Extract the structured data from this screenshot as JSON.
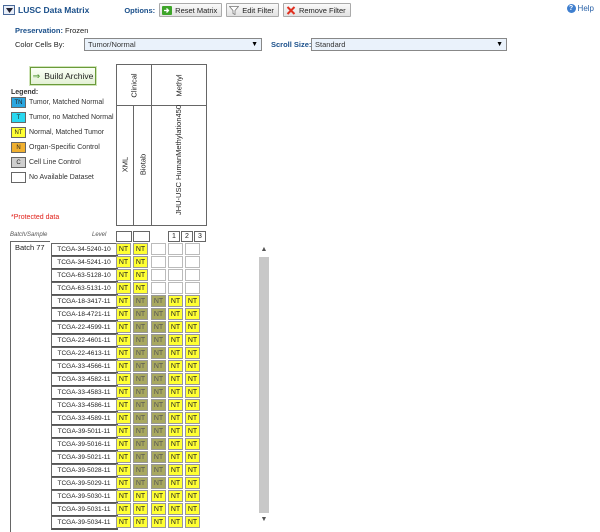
{
  "header": {
    "title": "LUSC Data Matrix",
    "options_label": "Options:",
    "reset_label": "Reset Matrix",
    "edit_label": "Edit Filter",
    "remove_label": "Remove Filter",
    "help_label": "Help"
  },
  "preservation": {
    "label": "Preservation:",
    "value": "Frozen"
  },
  "color_cells": {
    "label": "Color Cells By:",
    "value": "Tumor/Normal"
  },
  "scroll_size": {
    "label": "Scroll Size:",
    "value": "Standard"
  },
  "build_label": "Build Archive",
  "legend": {
    "title": "Legend:",
    "items": [
      {
        "code": "TN",
        "label": "Tumor, Matched Normal",
        "color": "#2aa6e0"
      },
      {
        "code": "T",
        "label": "Tumor, no Matched Normal",
        "color": "#2ad8f0"
      },
      {
        "code": "NT",
        "label": "Normal, Matched Tumor",
        "color": "#ffff33"
      },
      {
        "code": "N",
        "label": "Organ-Specific Control",
        "color": "#f0b030"
      },
      {
        "code": "C",
        "label": "Cell Line Control",
        "color": "#cfcfcf"
      },
      {
        "code": "",
        "label": "No Available Dataset",
        "color": "#ffffff"
      }
    ],
    "protected": "*Protected data"
  },
  "columns": {
    "clinical": "Clinical",
    "methyl": "Methyl",
    "xml": "XML",
    "biotab": "Biotab",
    "platform": "JHU-USC HumanMethylation450",
    "levels": [
      "1",
      "2",
      "3"
    ],
    "batch_sample_label": "Batch/Sample",
    "level_label": "Level"
  },
  "batch": {
    "label": "Batch 77"
  },
  "rows": [
    {
      "id": "TCGA-34-5240-10",
      "cells": [
        "NT",
        "NT",
        "",
        "",
        ""
      ]
    },
    {
      "id": "TCGA-34-5241-10",
      "cells": [
        "NT",
        "NT",
        "",
        "",
        ""
      ]
    },
    {
      "id": "TCGA-63-5128-10",
      "cells": [
        "NT",
        "NT",
        "",
        "",
        ""
      ]
    },
    {
      "id": "TCGA-63-5131-10",
      "cells": [
        "NT",
        "NT",
        "",
        "",
        ""
      ]
    },
    {
      "id": "TCGA-18-3417-11",
      "cells": [
        "NT",
        "NT*",
        "NT*",
        "NT",
        "NT"
      ]
    },
    {
      "id": "TCGA-18-4721-11",
      "cells": [
        "NT",
        "NT*",
        "NT*",
        "NT",
        "NT"
      ]
    },
    {
      "id": "TCGA-22-4599-11",
      "cells": [
        "NT",
        "NT*",
        "NT*",
        "NT",
        "NT"
      ]
    },
    {
      "id": "TCGA-22-4601-11",
      "cells": [
        "NT",
        "NT*",
        "NT*",
        "NT",
        "NT"
      ]
    },
    {
      "id": "TCGA-22-4613-11",
      "cells": [
        "NT",
        "NT*",
        "NT*",
        "NT",
        "NT"
      ]
    },
    {
      "id": "TCGA-33-4566-11",
      "cells": [
        "NT",
        "NT*",
        "NT*",
        "NT",
        "NT"
      ]
    },
    {
      "id": "TCGA-33-4582-11",
      "cells": [
        "NT",
        "NT*",
        "NT*",
        "NT",
        "NT"
      ]
    },
    {
      "id": "TCGA-33-4583-11",
      "cells": [
        "NT",
        "NT*",
        "NT*",
        "NT",
        "NT"
      ]
    },
    {
      "id": "TCGA-33-4586-11",
      "cells": [
        "NT",
        "NT*",
        "NT*",
        "NT",
        "NT"
      ]
    },
    {
      "id": "TCGA-33-4589-11",
      "cells": [
        "NT",
        "NT*",
        "NT*",
        "NT",
        "NT"
      ]
    },
    {
      "id": "TCGA-39-5011-11",
      "cells": [
        "NT",
        "NT*",
        "NT*",
        "NT",
        "NT"
      ]
    },
    {
      "id": "TCGA-39-5016-11",
      "cells": [
        "NT",
        "NT*",
        "NT*",
        "NT",
        "NT"
      ]
    },
    {
      "id": "TCGA-39-5021-11",
      "cells": [
        "NT",
        "NT*",
        "NT*",
        "NT",
        "NT"
      ]
    },
    {
      "id": "TCGA-39-5028-11",
      "cells": [
        "NT",
        "NT*",
        "NT*",
        "NT",
        "NT"
      ]
    },
    {
      "id": "TCGA-39-5029-11",
      "cells": [
        "NT",
        "NT*",
        "NT*",
        "NT",
        "NT"
      ]
    },
    {
      "id": "TCGA-39-5030-11",
      "cells": [
        "NT",
        "NT",
        "NT",
        "NT",
        "NT"
      ]
    },
    {
      "id": "TCGA-39-5031-11",
      "cells": [
        "NT",
        "NT",
        "NT",
        "NT",
        "NT"
      ]
    },
    {
      "id": "TCGA-39-5034-11",
      "cells": [
        "NT",
        "NT",
        "NT",
        "NT",
        "NT"
      ]
    }
  ],
  "colors": {
    "nt": "#ffff33",
    "nt_protected": "#a8a860",
    "accent": "#1a4f8a"
  }
}
